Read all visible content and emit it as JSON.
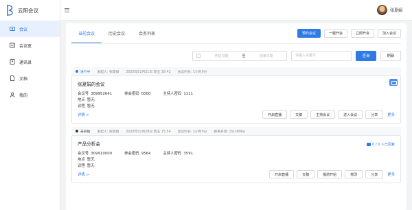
{
  "app": {
    "name": "云阳会议"
  },
  "sidebar": {
    "items": [
      {
        "label": "会议",
        "icon": "meeting-icon",
        "active": true
      },
      {
        "label": "会议室",
        "icon": "room-icon"
      },
      {
        "label": "通讯录",
        "icon": "contacts-icon"
      },
      {
        "label": "文档",
        "icon": "document-icon"
      },
      {
        "label": "我的",
        "icon": "user-icon"
      }
    ]
  },
  "user": {
    "name": "张夏娟"
  },
  "tabs": [
    {
      "label": "当前会议",
      "active": true
    },
    {
      "label": "历史会议"
    },
    {
      "label": "会务列表"
    }
  ],
  "header_actions": {
    "book": "预约会议",
    "open_now": "一键开会",
    "instant": "立即开会",
    "join": "加入会议"
  },
  "filters": {
    "start_placeholder": "开始日期",
    "separator": "至",
    "end_placeholder": "结束日期",
    "keyword_placeholder": "请输入关键字",
    "query": "查询",
    "refresh": "刷新"
  },
  "meetings": [
    {
      "status": "进行中",
      "status_color": "#2f7ae5",
      "initiator": "发起人: 张夏娟",
      "time": "2020年02月21日 周五 16:42",
      "duration": "会议时长: 1小时0分",
      "title": "张夏娟的会议",
      "id_label": "会议号",
      "id": "309952641",
      "pwd_label": "参会密码",
      "pwd": "0000",
      "host_label": "主持人密码",
      "host": "1111",
      "place_label": "地点",
      "place": "暂无",
      "agenda_label": "议程",
      "agenda": "暂无",
      "details": "详情 >",
      "buttons": [
        "开启直播",
        "文稿",
        "主持会议",
        "进入会议",
        "分享"
      ],
      "more": "更多"
    },
    {
      "status": "未开始",
      "status_color": "#333333",
      "initiator": "发起人: 张夏娟",
      "time": "2020年02月28日 周五 15:54",
      "duration": "会议时长: 1小时0分",
      "countdown": "距离开始: 29小时9分",
      "reply": "0 / 0 人已回复",
      "title": "产品分析会",
      "id_label": "会议号",
      "id": "309910000",
      "pwd_label": "参会密码",
      "pwd": "9564",
      "host_label": "主持人密码",
      "host": "3591",
      "place_label": "地点",
      "place": "暂无",
      "agenda_label": "议程",
      "agenda": "暂无",
      "details": "详情 >",
      "buttons": [
        "开启直播",
        "文稿",
        "提前开始",
        "修改",
        "分享"
      ],
      "more": "更多"
    }
  ]
}
